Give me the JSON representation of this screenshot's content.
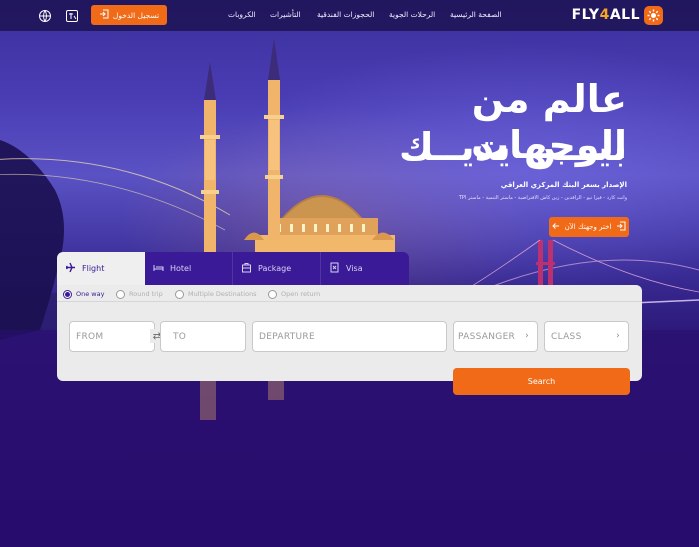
{
  "header": {
    "logo": {
      "part1": "FLY",
      "part2": "4",
      "part3": "ALL"
    },
    "nav": [
      {
        "label": "الصفحة الرئيسية"
      },
      {
        "label": "الرحلات الجوية"
      },
      {
        "label": "الحجوزات الفندقية"
      },
      {
        "label": "التأشيرات"
      },
      {
        "label": "الكروبات"
      }
    ],
    "login_label": "تسجيل الدخول",
    "icons": [
      "language-icon",
      "currency-icon"
    ]
  },
  "hero": {
    "title_line1": "عالم من الوجهات",
    "title_line2": "بيـــن يديــك",
    "subtitle": "الإصدار بسعر البنك المركزي العراقي",
    "payments": "وانت كارد - فيزا نيو - الرافدين - زين كاش الافتراضية - ماستر التنمية - ماستر TPI",
    "cta_label": "اختر وجهتك الآن"
  },
  "tabs": [
    {
      "label": "Flight",
      "icon": "plane-icon",
      "active": true
    },
    {
      "label": "Hotel",
      "icon": "bed-icon",
      "active": false
    },
    {
      "label": "Package",
      "icon": "package-icon",
      "active": false
    },
    {
      "label": "Visa",
      "icon": "visa-icon",
      "active": false
    }
  ],
  "trip_types": [
    {
      "label": "One way",
      "checked": true
    },
    {
      "label": "Round trip",
      "checked": false
    },
    {
      "label": "Multiple Destinations",
      "checked": false
    },
    {
      "label": "Open return",
      "checked": false
    }
  ],
  "fields": {
    "from": "FROM",
    "to": "TO",
    "departure": "DEPARTURE",
    "passanger": "PASSANGER",
    "class": "CLASS"
  },
  "search_label": "Search",
  "colors": {
    "accent": "#f06a17",
    "brand_purple": "#3a1a96",
    "panel": "#ebebeb"
  }
}
